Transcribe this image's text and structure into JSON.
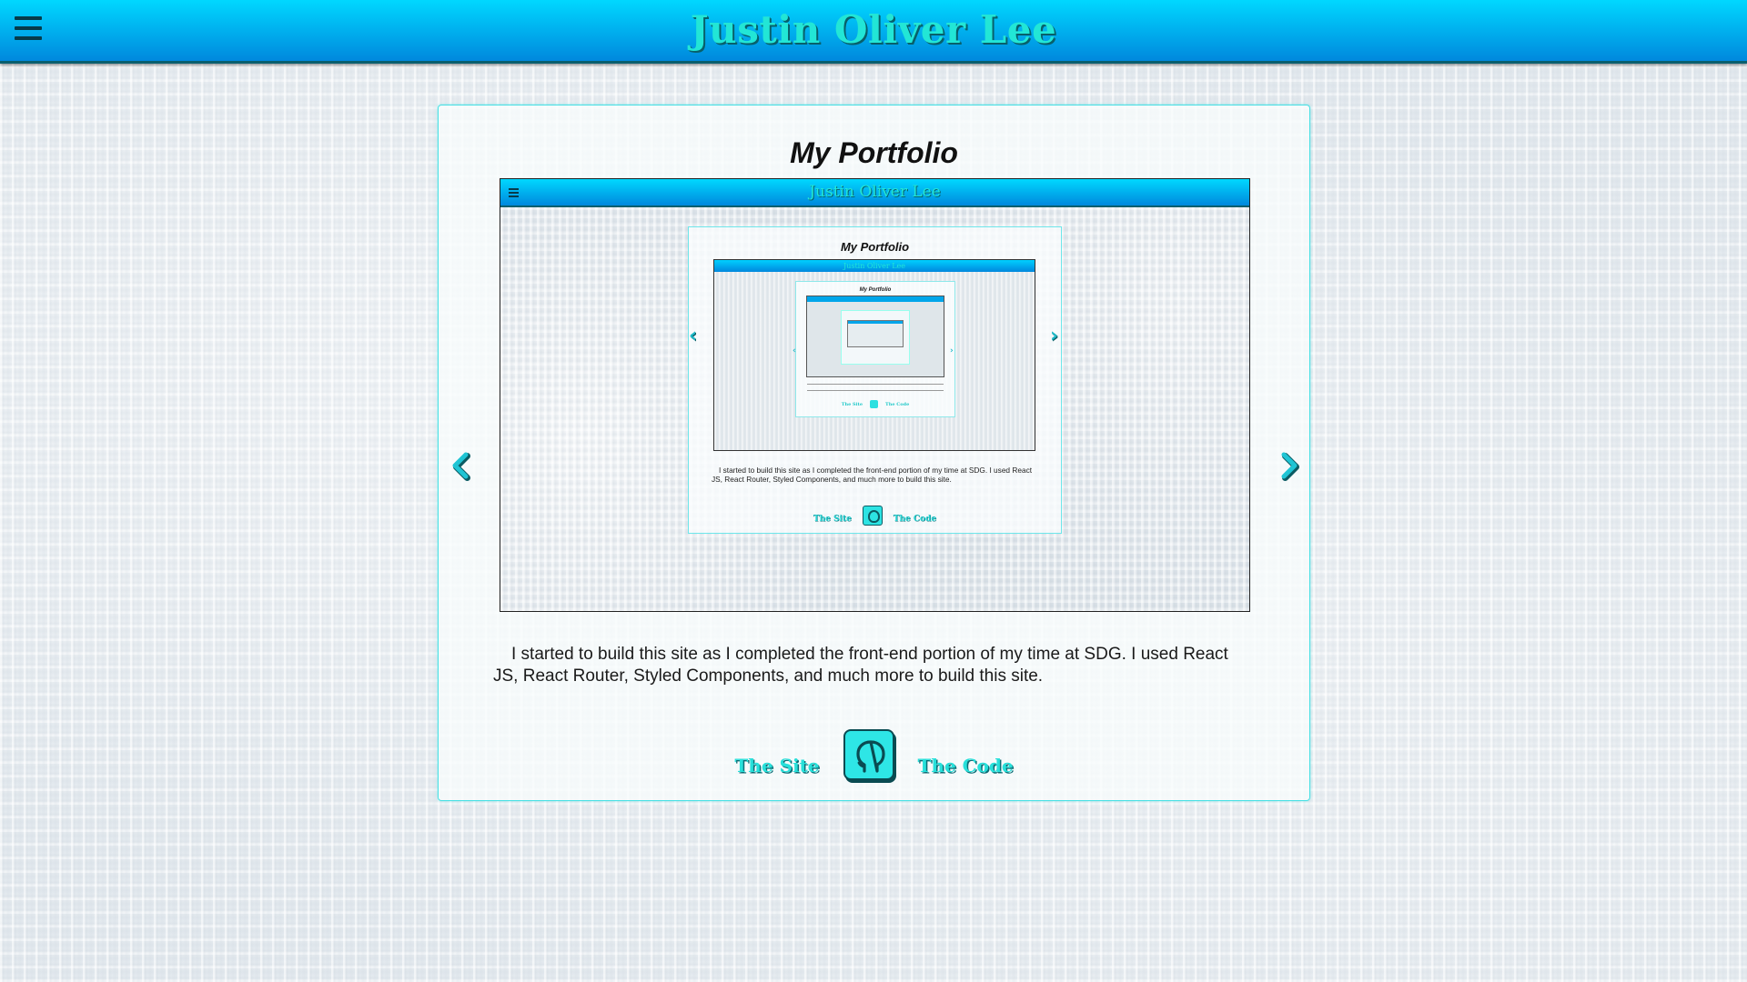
{
  "header": {
    "title": "Justin Oliver Lee",
    "menu_icon": "hamburger-menu-icon"
  },
  "portfolio": {
    "title": "My Portfolio",
    "description": "I started to build this site as I completed the front-end portion of my time at SDG. I used React JS, React Router, Styled Components, and much more to build this site.",
    "links": {
      "site_label": "The Site",
      "code_label": "The Code",
      "github_icon": "github-icon"
    },
    "nav": {
      "prev_icon": "chevron-left-icon",
      "next_icon": "chevron-right-icon"
    }
  },
  "screenshot": {
    "header_title": "Justin Oliver Lee",
    "card_title": "My Portfolio",
    "description": "I started to build this site as I completed the front-end portion of my time at SDG. I used React JS, React Router, Styled Components, and much more to build this site.",
    "site_label": "The Site",
    "code_label": "The Code",
    "nested_title": "My Portfolio"
  },
  "colors": {
    "header_gradient_top": "#00d8ff",
    "header_gradient_bottom": "#0088dd",
    "accent_cyan": "#27e0da",
    "accent_dark": "#0b6e76",
    "card_border": "#46e0e4"
  }
}
